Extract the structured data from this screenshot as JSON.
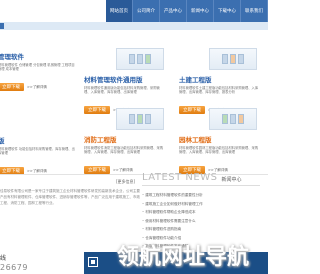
{
  "nav": {
    "items": [
      "网站首页",
      "公司简介",
      "产品中心",
      "新闻中心",
      "下载中心",
      "联系我们"
    ],
    "active_index": 0
  },
  "products": [
    {
      "title": "管理软件",
      "desc": "材料管理软件 仓储管理 分包管理 机械管理 工程项目管理 成本管理",
      "download": "立即下载",
      "more": ">>了解详情"
    },
    {
      "title": "材料管理软件通用版",
      "desc": "材料管理软件通用版功能包括材料采购管理、采购管理、入库管理、库存管理、出库管理",
      "download": "立即下载",
      "more": ">>了解详情"
    },
    {
      "title": "土建工程版",
      "desc": "材料管理软件土建工程版功能包括材料采购管理、入库管理、出库管理、库存管理、报表分析",
      "download": "立即下载",
      "more": ">>了解详情"
    },
    {
      "title": "版",
      "desc": "材料管理软件 功能包括材料采购管理、库存管理、出库管理",
      "download": "立即下载",
      "more": ">>了解详情"
    },
    {
      "title": "消防工程版",
      "desc": "材料管理软件消防工程版功能包括材料采购管理、采购管理、入库管理、库存管理、出库管理",
      "download": "立即下载",
      "more": ">>了解详情"
    },
    {
      "title": "园林工程版",
      "desc": "材料管理软件园林工程版功能包括材料采购管理、采购管理、入库管理、库存管理、出库管理",
      "download": "立即下载",
      "more": ">>了解详情"
    }
  ],
  "about": {
    "more_link": "[更多信息]",
    "intro": "佳易软件有限公司是一家专注于建筑施工企业材料管理软件研发的高新技术企业，公司主要产品有材料管理软件、仓库管理软件、进销存管理软件等，产品广泛应用于建筑施工、市政工程、消防工程、园林工程等行业。"
  },
  "news": {
    "title_en": "LATEST NEWS",
    "title_cn": "新闻中心",
    "items": [
      "建筑工程材料管理软件的重要性分析",
      "建筑施工企业如何做好材料管理工作",
      "材料管理软件帮助企业降低成本",
      "使用材料管理软件需要注意什么",
      "材料管理软件选购指南",
      "仓库管理软件功能介绍",
      "新版材料管理软件发布通知"
    ]
  },
  "contact": {
    "label": "线",
    "phone": "26679"
  },
  "watermark": "领航网址导航"
}
